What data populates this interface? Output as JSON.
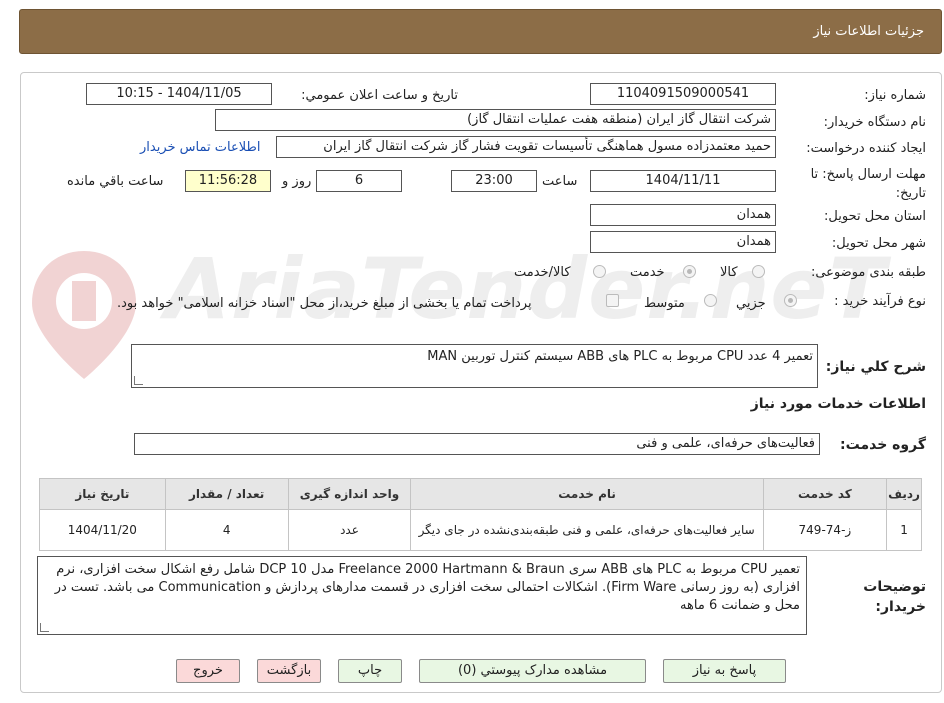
{
  "header": {
    "title": "جزئیات اطلاعات نیاز"
  },
  "watermark": "AriaTender.neT",
  "form": {
    "need_number_label": "شماره نیاز:",
    "need_number_value": "1104091509000541",
    "announce_label": "تاریخ و ساعت اعلان عمومي:",
    "announce_value": "1404/11/05 - 10:15",
    "buyer_label": "نام دستگاه خریدار:",
    "buyer_value": "شرکت انتقال گاز ایران (منطقه هفت عملیات انتقال گاز)",
    "creator_label": "ایجاد کننده درخواست:",
    "creator_value": "حمید  معتمدزاده مسول هماهنگی تأسیسات تقویت فشار گاز  شرکت انتقال گاز ایران",
    "contact_link": "اطلاعات تماس خریدار",
    "deadline_label": "مهلت ارسال پاسخ: تا تاریخ:",
    "deadline_date": "1404/11/11",
    "time_label": "ساعت",
    "deadline_time": "23:00",
    "days_value": "6",
    "days_label": "روز و",
    "remaining_value": "11:56:28",
    "remaining_label": "ساعت باقي مانده",
    "province_label": "استان محل تحویل:",
    "province_value": "همدان",
    "city_label": "شهر محل تحویل:",
    "city_value": "همدان",
    "category_label": "طبقه بندی موضوعی:",
    "category_options": [
      "کالا",
      "خدمت",
      "کالا/خدمت"
    ],
    "process_label": "نوع فرآیند خرید :",
    "process_options": [
      "جزيي",
      "متوسط"
    ],
    "payment_note": "پرداخت تمام یا بخشی از مبلغ خرید،از محل \"اسناد خزانه اسلامی\" خواهد بود.",
    "summary_label": "شرح كلي نياز:",
    "summary_value": "تعمیر 4 عدد CPU مربوط به PLC های ABB سیستم کنترل توربین MAN",
    "services_title": "اطلاعات خدمات مورد نیاز",
    "service_group_label": "گروه خدمت:",
    "service_group_value": "فعالیت‌های حرفه‌ای، علمی و فنی",
    "buyer_notes_label": "توضیحات خریدار:",
    "buyer_notes_value": "تعمیر CPU مربوط به PLC های ABB سری Freelance 2000 Hartmann & Braun مدل DCP 10 شامل رفع اشکال سخت افزاری، نرم افزاری (به روز رسانی Firm Ware). اشکالات احتمالی سخت افزاری در قسمت مدارهای پردازش و Communication  می باشد. تست در محل و ضمانت 6 ماهه"
  },
  "table": {
    "headers": [
      "ردیف",
      "کد خدمت",
      "نام خدمت",
      "واحد اندازه گیری",
      "تعداد / مقدار",
      "تاریخ نیاز"
    ],
    "rows": [
      [
        "1",
        "ز-74-749",
        "سایر فعالیت‌های حرفه‌ای، علمی و فنی طبقه‌بندی‌نشده در جای دیگر",
        "عدد",
        "4",
        "1404/11/20"
      ]
    ]
  },
  "buttons": {
    "reply": "پاسخ به نیاز",
    "attachments": "مشاهده مدارک پیوستي (0)",
    "print": "چاپ",
    "back": "بازگشت",
    "exit": "خروج"
  }
}
